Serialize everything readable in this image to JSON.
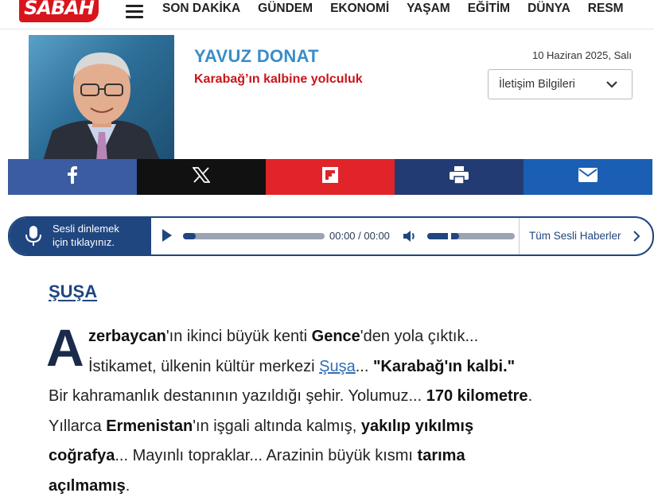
{
  "site": {
    "logo_text": "SABAH",
    "brand_color": "#d9151b"
  },
  "nav": {
    "items": [
      "SON DAKİKA",
      "GÜNDEM",
      "EKONOMİ",
      "YAŞAM",
      "EĞİTİM",
      "DÜNYA",
      "RESM"
    ]
  },
  "author": {
    "name": "YAVUZ DONAT",
    "article_title": "Karabağ’ın kalbine yolculuk",
    "date": "10 Haziran 2025, Salı",
    "contact_label": "İletişim Bilgileri"
  },
  "share": {
    "icons": [
      "facebook-icon",
      "x-icon",
      "flipboard-icon",
      "print-icon",
      "email-icon"
    ],
    "colors": [
      "#3b5ca0",
      "#111111",
      "#e02429",
      "#233b73",
      "#1a5fb4"
    ]
  },
  "audio": {
    "prompt_line1": "Sesli dinlemek",
    "prompt_line2": "için tıklayınız.",
    "time": "00:00 / 00:00",
    "all_label": "Tüm Sesli Haberler",
    "accent": "#20467f"
  },
  "article": {
    "section_heading": "ŞUŞA",
    "drop_cap": "A",
    "p1_l1_a": "zerbaycan",
    "p1_l1_b": "'ın ikinci büyük kenti ",
    "p1_l1_c": "Gence",
    "p1_l1_d": "'den yola çıktık...",
    "p1_l2_a": "İstikamet, ülkenin kültür merkezi ",
    "p1_l2_link": "Şuşa",
    "p1_l2_b": "... ",
    "p1_l2_c": "\"Karabağ'ın kalbi.\"",
    "p1_l3_a": "Bir kahramanlık destanının yazıldığı şehir. Yolumuz... ",
    "p1_l3_b": "170 kilometre",
    "p1_l3_c": ".",
    "p1_l4_a": "Yıllarca ",
    "p1_l4_b": "Ermenistan",
    "p1_l4_c": "'ın işgali altında kalmış, ",
    "p1_l4_d": "yakılıp yıkılmış",
    "p1_l5_a": "coğrafya",
    "p1_l5_b": "... Mayınlı topraklar... Arazinin büyük kısmı ",
    "p1_l5_c": "tarıma",
    "p1_l6_a": "açılmamış",
    "p1_l6_b": "."
  }
}
